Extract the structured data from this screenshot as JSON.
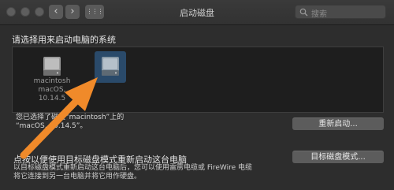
{
  "window": {
    "title": "启动磁盘",
    "search_placeholder": "搜索"
  },
  "toolbar": {
    "back_label": "‹",
    "forward_label": "›",
    "grid_label": "⋮⋮⋮"
  },
  "main": {
    "heading": "请选择用来启动电脑的系统",
    "disks": [
      {
        "name": "macintosh",
        "subtitle": "macOS, 10.14.5",
        "selected": false
      },
      {
        "name": "",
        "subtitle": "",
        "selected": true
      }
    ],
    "status_line1": "您已选择了磁盘“macintosh”上的",
    "status_line2": "“macOS, 10.14.5”。",
    "restart_label": "重新启动...",
    "tdm_title": "点按以便使用目标磁盘模式重新启动这台电脑",
    "tdm_desc_line1": "以目标磁盘模式重新启动这台电脑后，您可以使用雷雳电缆或 FireWire 电缆",
    "tdm_desc_line2": "将它连接到另一台电脑并将它用作硬盘。",
    "tdm_button_label": "目标磁盘模式..."
  },
  "colors": {
    "accent_arrow": "#f08a2a",
    "selection": "#2a4a6a"
  }
}
